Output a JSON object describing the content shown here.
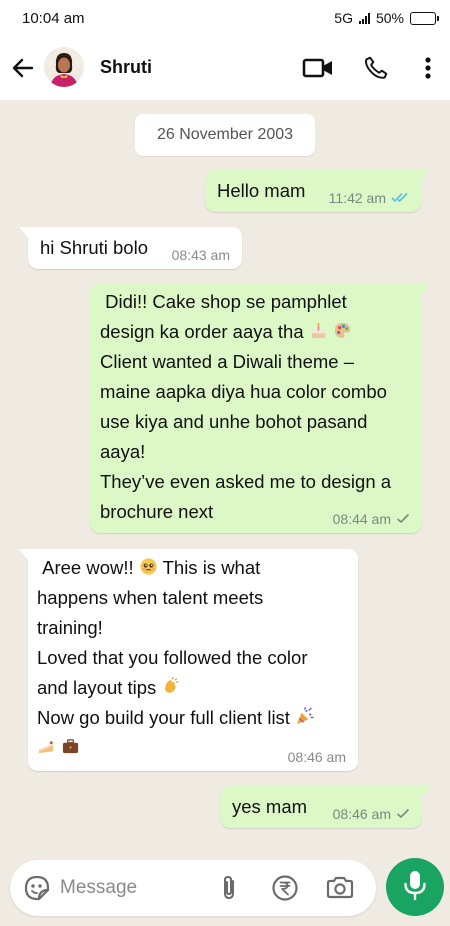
{
  "status_bar": {
    "time": "10:04 am",
    "network": "5G",
    "battery": "50%",
    "battery_level": 0.5
  },
  "header": {
    "contact_name": "Shruti"
  },
  "chat": {
    "date_divider": "26 November 2003",
    "messages": [
      {
        "direction": "out",
        "text": "Hello mam",
        "time": "11:42 am",
        "status": "read"
      },
      {
        "direction": "in",
        "text": "hi Shruti bolo",
        "time": "08:43 am"
      },
      {
        "direction": "out",
        "lines": [
          " Didi!! Cake shop se pamphlet",
          "design ka order aaya tha",
          "Client wanted a Diwali theme –",
          "maine aapka diya hua color combo",
          "use kiya and unhe bohot pasand",
          "aaya!",
          "They’ve even asked me to design a",
          "brochure next"
        ],
        "time": "08:44 am",
        "status": "sent",
        "emojis": [
          "birthday-cake",
          "artist-palette"
        ]
      },
      {
        "direction": "in",
        "lines": [
          " Aree wow!!",
          " This is what",
          "happens when talent meets",
          "training!",
          "Loved that you followed the color",
          "and layout tips",
          "Now go build your full client list"
        ],
        "time": "08:46 am",
        "emojis": [
          "pleading-face",
          "clapping-hands",
          "party-popper",
          "cake-slice",
          "briefcase"
        ]
      },
      {
        "direction": "out",
        "text": "yes mam",
        "time": "08:46 am",
        "status": "sent"
      }
    ]
  },
  "composer": {
    "placeholder": "Message"
  },
  "colors": {
    "outgoing_bubble": "#dcf8c6",
    "incoming_bubble": "#ffffff",
    "chat_background": "#efeae2",
    "mic_button": "#1aa462",
    "read_tick": "#53bdeb"
  }
}
